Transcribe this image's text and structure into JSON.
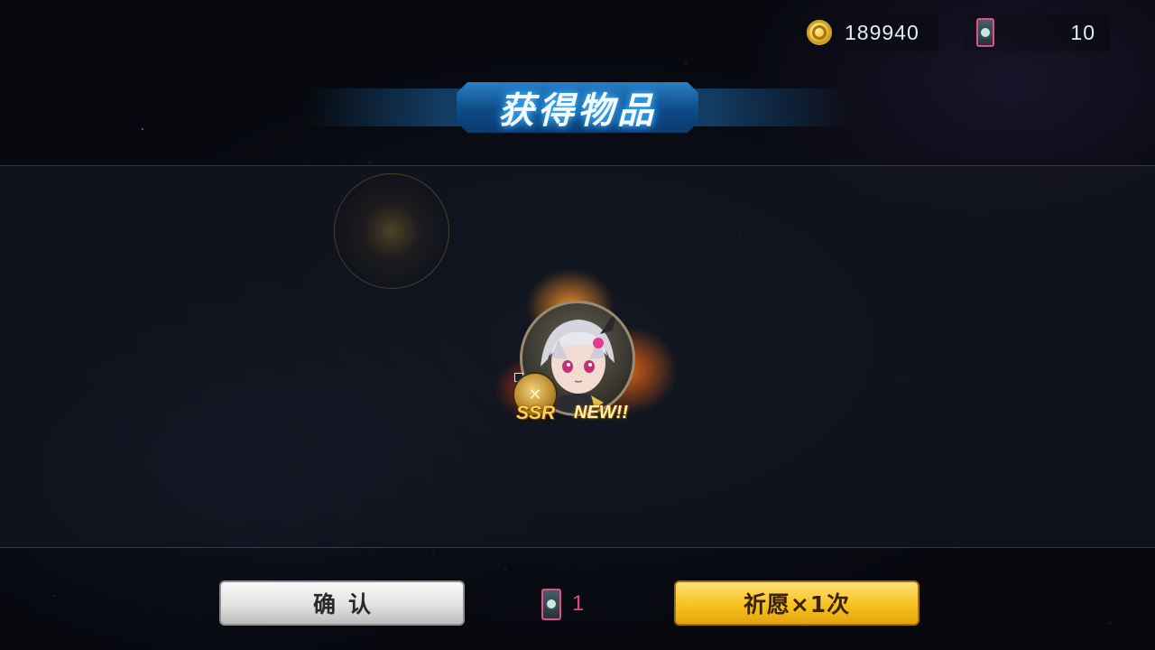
{
  "currency": {
    "gold": "189940",
    "gold_icon": "gold-coin-icon",
    "tickets": "10",
    "ticket_icon": "wish-card-icon"
  },
  "title": "获得物品",
  "reward": {
    "rarity": "SSR",
    "new_label": "NEW!!",
    "portrait_icon": "character-portrait",
    "badge_icon": "crossed-swords-icon"
  },
  "actions": {
    "confirm_label": "确认",
    "cost_amount": "1",
    "cost_icon": "wish-card-icon",
    "pray_label": "祈愿×1次"
  },
  "colors": {
    "pray_button": "#f7c21f",
    "confirm_button": "#e2e2e2",
    "banner": "#0e4a86",
    "cost_text": "#e3467f",
    "ssr_text": "#ffd24a"
  }
}
